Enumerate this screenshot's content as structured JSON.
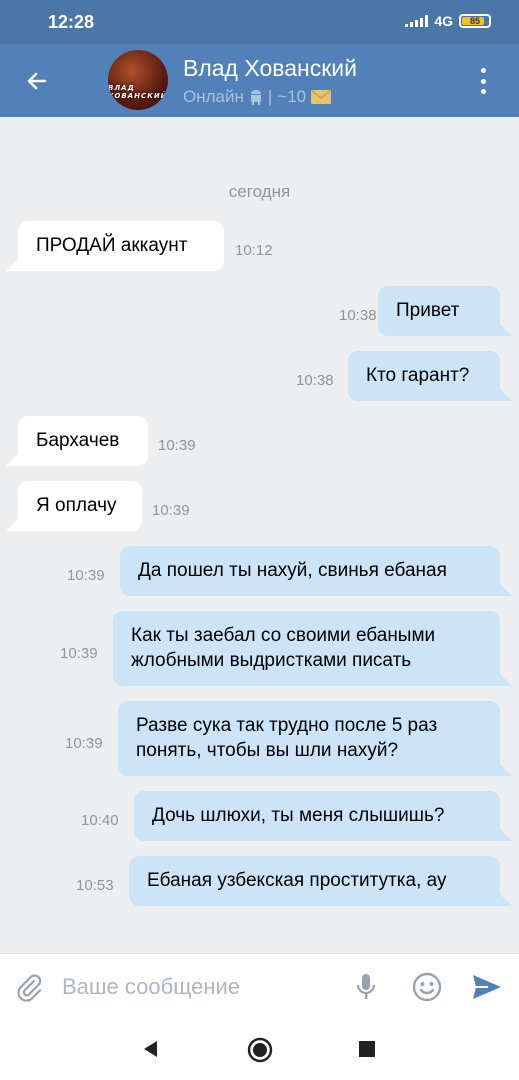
{
  "status_bar": {
    "time": "12:28",
    "network": "4G",
    "battery": "85",
    "battery_level": 0.85
  },
  "header": {
    "avatar_text": "ВЛАД ХОВАНСКИЙ",
    "name": "Влад Хованский",
    "status_online": "Онлайн",
    "status_sep": "|",
    "status_count": "~10"
  },
  "chat": {
    "date_label": "сегодня",
    "messages": [
      {
        "dir": "in",
        "lines": [
          "ПРОДАЙ аккаунт"
        ],
        "time": "10:12"
      },
      {
        "dir": "out",
        "lines": [
          "Привет"
        ],
        "time": "10:38"
      },
      {
        "dir": "out",
        "lines": [
          "Кто гарант?"
        ],
        "time": "10:38"
      },
      {
        "dir": "in",
        "lines": [
          "Бархачев"
        ],
        "time": "10:39"
      },
      {
        "dir": "in",
        "lines": [
          "Я оплачу"
        ],
        "time": "10:39"
      },
      {
        "dir": "out",
        "lines": [
          "Да пошел ты нахуй, свинья ебаная"
        ],
        "time": "10:39"
      },
      {
        "dir": "out",
        "lines": [
          "Как ты заебал со своими ебаными",
          "жлобными выдристками писать"
        ],
        "time": "10:39"
      },
      {
        "dir": "out",
        "lines": [
          "Разве сука так трудно после 5 раз",
          "понять, чтобы вы шли нахуй?"
        ],
        "time": "10:39"
      },
      {
        "dir": "out",
        "lines": [
          "Дочь шлюхи, ты меня слышишь?"
        ],
        "time": "10:40"
      },
      {
        "dir": "out",
        "lines": [
          "Ебаная узбекская проститутка, ау"
        ],
        "time": "10:53"
      }
    ]
  },
  "composer": {
    "placeholder": "Ваше сообщение",
    "value": ""
  },
  "colors": {
    "header": "#5181b8",
    "status_bar": "#4a76a8",
    "background": "#edeef0",
    "out_bubble": "#cce4f7",
    "in_bubble": "#ffffff",
    "accent": "#5181b8"
  },
  "icons": {
    "back": "back-arrow-icon",
    "menu": "more-vertical-icon",
    "android": "android-icon",
    "mail": "envelope-icon",
    "attach": "paperclip-icon",
    "mic": "microphone-icon",
    "emoji": "smile-icon",
    "send": "send-icon"
  }
}
